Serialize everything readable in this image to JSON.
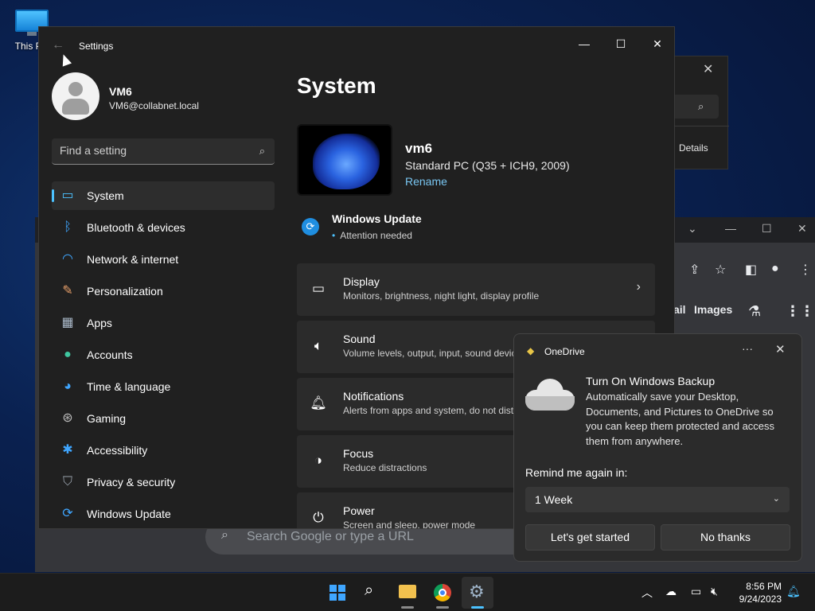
{
  "desktop": {
    "icon_label": "This PC"
  },
  "bg_window_1": {
    "details_label": "Details"
  },
  "bg_browser": {
    "images_link": "Images",
    "mail_link": "ail",
    "search_placeholder": "Search Google or type a URL"
  },
  "settings": {
    "window_title": "Settings",
    "user": {
      "name": "VM6",
      "email": "VM6@collabnet.local"
    },
    "find_placeholder": "Find a setting",
    "nav": [
      {
        "label": "System",
        "icon": "monitor-icon",
        "active": true
      },
      {
        "label": "Bluetooth & devices",
        "icon": "bluetooth-icon"
      },
      {
        "label": "Network & internet",
        "icon": "wifi-icon"
      },
      {
        "label": "Personalization",
        "icon": "brush-icon"
      },
      {
        "label": "Apps",
        "icon": "apps-icon"
      },
      {
        "label": "Accounts",
        "icon": "person-icon"
      },
      {
        "label": "Time & language",
        "icon": "globe-clock-icon"
      },
      {
        "label": "Gaming",
        "icon": "controller-icon"
      },
      {
        "label": "Accessibility",
        "icon": "accessibility-icon"
      },
      {
        "label": "Privacy & security",
        "icon": "shield-icon"
      },
      {
        "label": "Windows Update",
        "icon": "update-icon"
      }
    ],
    "page_title": "System",
    "device": {
      "name": "vm6",
      "model": "Standard PC (Q35 + ICH9, 2009)",
      "rename_label": "Rename"
    },
    "update": {
      "title": "Windows Update",
      "status": "Attention needed"
    },
    "cards": [
      {
        "title": "Display",
        "subtitle": "Monitors, brightness, night light, display profile",
        "icon": "display-icon"
      },
      {
        "title": "Sound",
        "subtitle": "Volume levels, output, input, sound devices",
        "icon": "speaker-icon"
      },
      {
        "title": "Notifications",
        "subtitle": "Alerts from apps and system, do not disturb",
        "icon": "bell-icon"
      },
      {
        "title": "Focus",
        "subtitle": "Reduce distractions",
        "icon": "focus-icon"
      },
      {
        "title": "Power",
        "subtitle": "Screen and sleep, power mode",
        "icon": "power-icon"
      }
    ]
  },
  "onedrive": {
    "app_name": "OneDrive",
    "headline": "Turn On Windows Backup",
    "body": "Automatically save your Desktop, Documents, and Pictures to OneDrive so you can keep them protected and access them from anywhere.",
    "remind_label": "Remind me again in:",
    "remind_value": "1 Week",
    "primary_button": "Let's get started",
    "secondary_button": "No thanks"
  },
  "taskbar": {
    "time": "8:56 PM",
    "date": "9/24/2023",
    "accent_color": "#4cc2ff"
  }
}
